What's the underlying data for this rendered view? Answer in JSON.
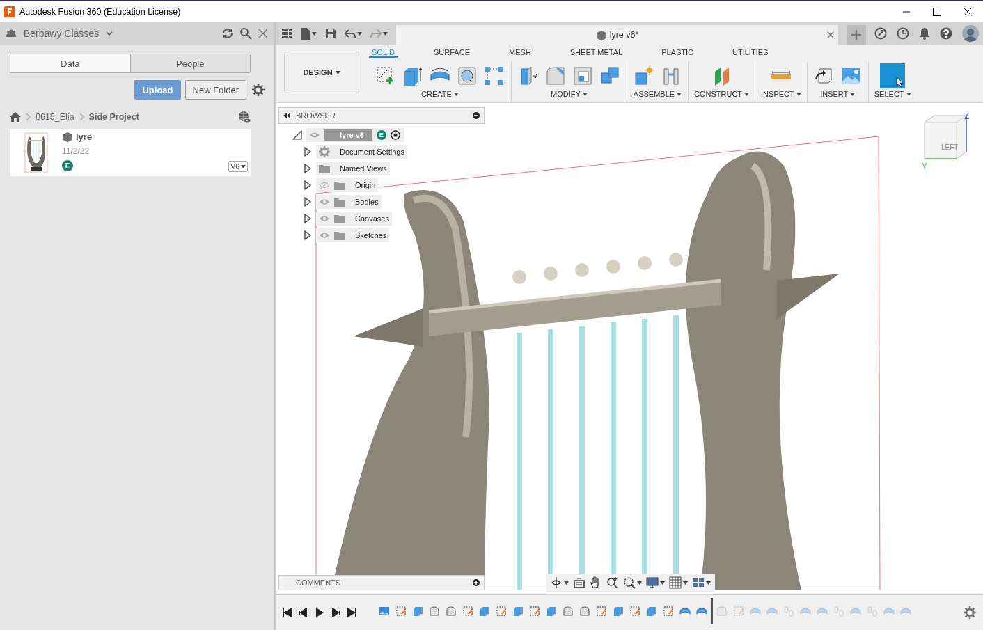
{
  "window": {
    "title": "Autodesk Fusion 360 (Education License)"
  },
  "data_panel": {
    "team": "Berbawy Classes",
    "tabs": [
      {
        "label": "Data",
        "selected": true
      },
      {
        "label": "People",
        "selected": false
      }
    ],
    "buttons": [
      {
        "label": "Upload",
        "kind": "primary"
      },
      {
        "label": "New Folder",
        "kind": "secondary"
      }
    ],
    "breadcrumb": [
      "0615_Elia",
      "Side Project"
    ],
    "files": [
      {
        "name": "lyre",
        "date": "11/2/22",
        "owner": "E",
        "version": "V6"
      }
    ]
  },
  "document_tab": {
    "title": "lyre v6*"
  },
  "toolbar": {
    "workspace": "DESIGN",
    "tabs": [
      {
        "label": "SOLID",
        "selected": true
      },
      {
        "label": "SURFACE",
        "selected": false
      },
      {
        "label": "MESH",
        "selected": false
      },
      {
        "label": "SHEET METAL",
        "selected": false
      },
      {
        "label": "PLASTIC",
        "selected": false
      },
      {
        "label": "UTILITIES",
        "selected": false
      }
    ],
    "groups": [
      {
        "label": "CREATE",
        "tools": [
          {
            "kind": "sketch"
          },
          {
            "kind": "extrude"
          },
          {
            "kind": "revolve"
          },
          {
            "kind": "hole"
          },
          {
            "kind": "pattern"
          }
        ]
      },
      {
        "label": "MODIFY",
        "tools": [
          {
            "kind": "presspull"
          },
          {
            "kind": "fillet"
          },
          {
            "kind": "shell"
          },
          {
            "kind": "combine"
          }
        ]
      },
      {
        "label": "ASSEMBLE",
        "tools": [
          {
            "kind": "component"
          },
          {
            "kind": "joint"
          }
        ]
      },
      {
        "label": "CONSTRUCT",
        "tools": [
          {
            "kind": "plane"
          }
        ]
      },
      {
        "label": "INSPECT",
        "tools": [
          {
            "kind": "measure"
          }
        ]
      },
      {
        "label": "INSERT",
        "tools": [
          {
            "kind": "insert"
          },
          {
            "kind": "image"
          }
        ]
      },
      {
        "label": "SELECT",
        "tools": [
          {
            "kind": "select"
          }
        ]
      }
    ]
  },
  "browser": {
    "title": "BROWSER",
    "root": {
      "label": "lyre v6",
      "owner": "E",
      "expanded": true
    },
    "items": [
      {
        "label": "Document Settings",
        "kind": "settings",
        "expanded": false
      },
      {
        "label": "Named Views",
        "kind": "folder",
        "expanded": false
      },
      {
        "label": "Origin",
        "kind": "folder",
        "visible": false,
        "expanded": false
      },
      {
        "label": "Bodies",
        "kind": "folder",
        "visible": true,
        "expanded": false
      },
      {
        "label": "Canvases",
        "kind": "folder",
        "visible": true,
        "expanded": false
      },
      {
        "label": "Sketches",
        "kind": "folder",
        "visible": true,
        "expanded": false
      }
    ]
  },
  "view_cube": {
    "face": "LEFT",
    "axes": [
      "Z",
      "Y"
    ]
  },
  "comments": {
    "title": "COMMENTS"
  },
  "nav_tools": [
    {
      "kind": "orbit"
    },
    {
      "kind": "lookat"
    },
    {
      "kind": "pan"
    },
    {
      "kind": "zoom"
    },
    {
      "kind": "fit"
    },
    {
      "kind": "display"
    },
    {
      "kind": "grid"
    },
    {
      "kind": "viewports"
    }
  ],
  "timeline": {
    "features": [
      {
        "kind": "canvas",
        "rolled_back": false
      },
      {
        "kind": "sketch",
        "rolled_back": false
      },
      {
        "kind": "extrude",
        "rolled_back": false
      },
      {
        "kind": "fillet",
        "rolled_back": false
      },
      {
        "kind": "fillet",
        "rolled_back": false
      },
      {
        "kind": "sketch",
        "rolled_back": false
      },
      {
        "kind": "extrude",
        "rolled_back": false
      },
      {
        "kind": "sketch",
        "rolled_back": false
      },
      {
        "kind": "extrude",
        "rolled_back": false
      },
      {
        "kind": "sketch",
        "rolled_back": false
      },
      {
        "kind": "extrude",
        "rolled_back": false
      },
      {
        "kind": "fillet",
        "rolled_back": false
      },
      {
        "kind": "fillet",
        "rolled_back": false
      },
      {
        "kind": "sketch",
        "rolled_back": false
      },
      {
        "kind": "extrude",
        "rolled_back": false
      },
      {
        "kind": "sketch",
        "rolled_back": false
      },
      {
        "kind": "extrude",
        "rolled_back": false
      },
      {
        "kind": "sketch",
        "rolled_back": false
      },
      {
        "kind": "revolve",
        "rolled_back": false
      },
      {
        "kind": "revolve",
        "rolled_back": false
      },
      {
        "kind": "fillet",
        "rolled_back": true
      },
      {
        "kind": "sketch",
        "rolled_back": true
      },
      {
        "kind": "revolve",
        "rolled_back": true
      },
      {
        "kind": "revolve",
        "rolled_back": true
      },
      {
        "kind": "joint",
        "rolled_back": true
      },
      {
        "kind": "revolve",
        "rolled_back": true
      },
      {
        "kind": "revolve",
        "rolled_back": true
      },
      {
        "kind": "joint",
        "rolled_back": true
      },
      {
        "kind": "revolve",
        "rolled_back": true
      },
      {
        "kind": "joint",
        "rolled_back": true
      },
      {
        "kind": "revolve",
        "rolled_back": true
      },
      {
        "kind": "revolve",
        "rolled_back": true
      }
    ]
  }
}
